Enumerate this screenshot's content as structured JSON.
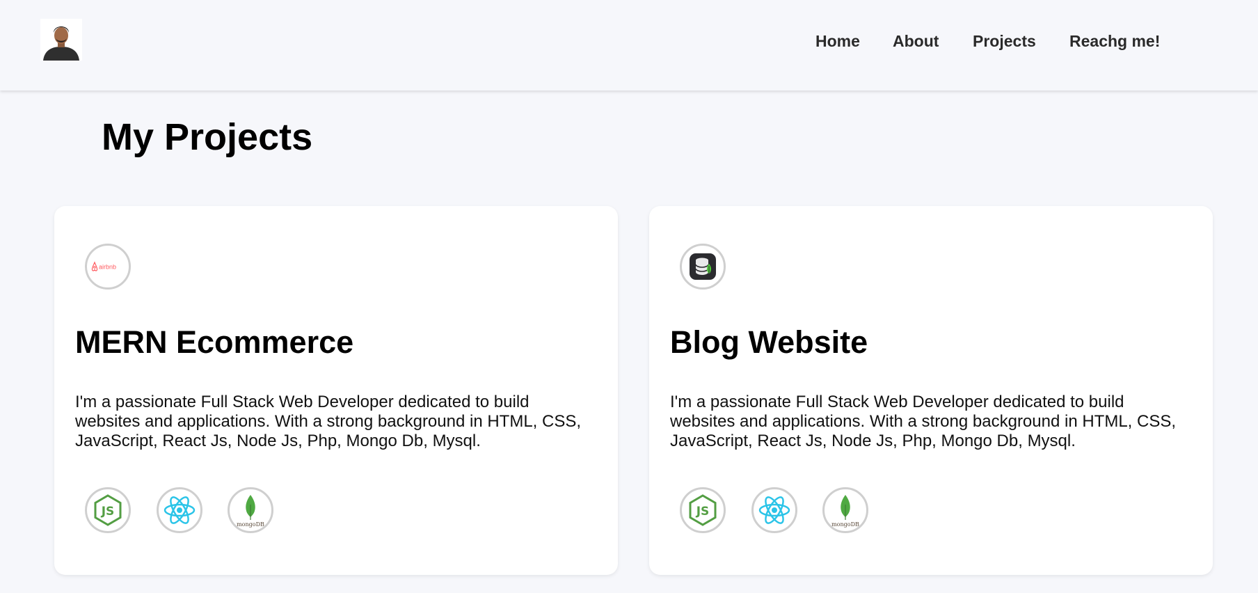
{
  "header": {
    "nav": [
      "Home",
      "About",
      "Projects",
      "Reachg me!"
    ]
  },
  "page_title": "My Projects",
  "projects": [
    {
      "title": "MERN Ecommerce",
      "logo_icon": "airbnb-logo-icon",
      "logo_text": "airbnb",
      "description": "I'm a passionate Full Stack Web Developer dedicated to build websites and applications. With a strong background in HTML, CSS, JavaScript, React Js, Node Js, Php, Mongo Db, Mysql.",
      "tech": [
        "nodejs-icon",
        "react-icon",
        "mongodb-icon"
      ],
      "mongo_label": "mongoDB"
    },
    {
      "title": "Blog Website",
      "logo_icon": "database-app-icon",
      "description": "I'm a passionate Full Stack Web Developer dedicated to build websites and applications. With a strong background in HTML, CSS, JavaScript, React Js, Node Js, Php, Mongo Db, Mysql.",
      "tech": [
        "nodejs-icon",
        "react-icon",
        "mongodb-icon"
      ],
      "mongo_label": "mongoDB"
    }
  ],
  "colors": {
    "background": "#f6f7fb",
    "card": "#ffffff",
    "nav_text": "#2a2a2a",
    "node_green": "#539e43",
    "react_cyan": "#2bc4e8",
    "mongo_green": "#4fa942",
    "airbnb_red": "#ff5a5f"
  }
}
